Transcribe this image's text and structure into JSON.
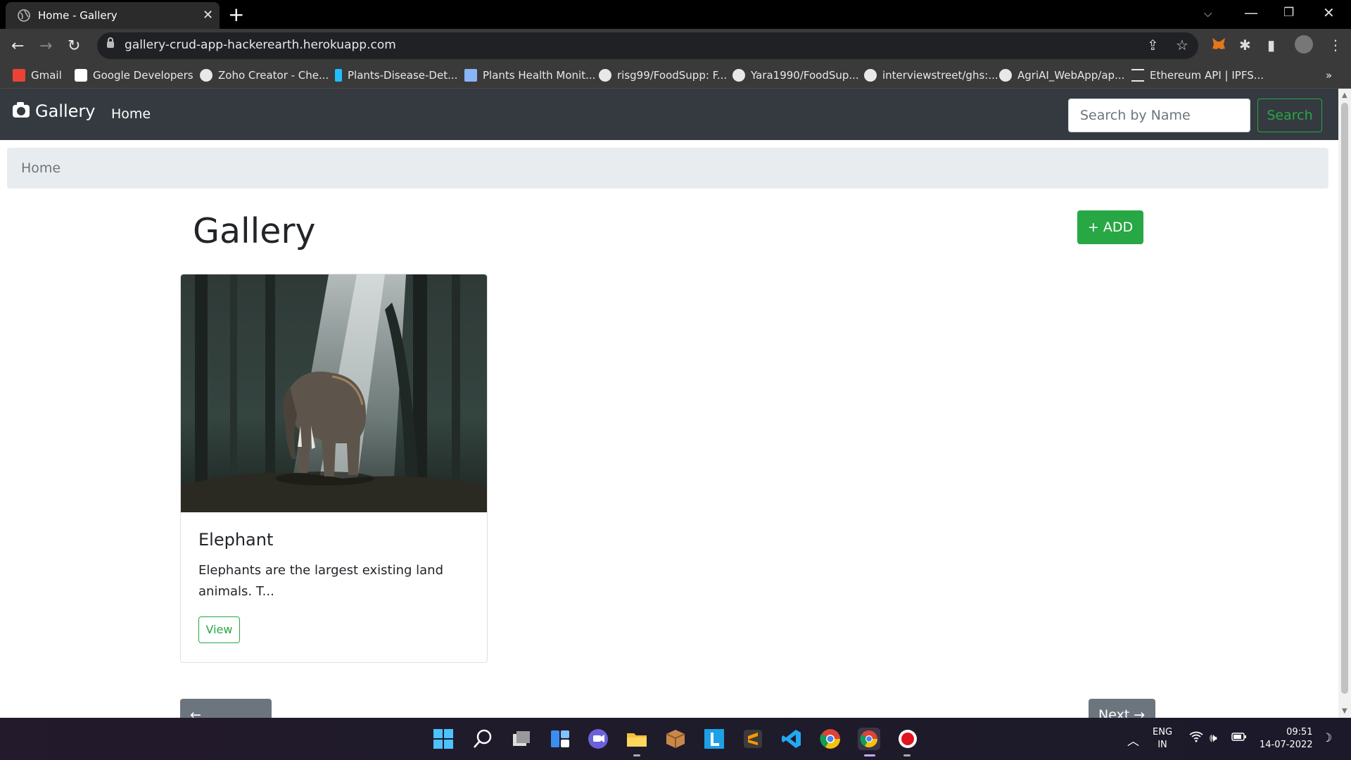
{
  "browser": {
    "tab_title": "Home - Gallery",
    "tab_close": "✕",
    "new_tab": "+",
    "url": "gallery-crud-app-hackerearth.herokuapp.com",
    "bookmarks": [
      "Gmail",
      "Google Developers",
      "Zoho Creator - Che...",
      "Plants-Disease-Det...",
      "Plants Health Monit...",
      "risg99/FoodSupp: F...",
      "Yara1990/FoodSup...",
      "interviewstreet/ghs:...",
      "AgriAI_WebApp/ap...",
      "Ethereum API | IPFS..."
    ],
    "bookmarks_more": "»"
  },
  "navbar": {
    "brand": "Gallery",
    "home_link": "Home",
    "search_placeholder": "Search by Name",
    "search_button": "Search"
  },
  "breadcrumb": {
    "current": "Home"
  },
  "main": {
    "title": "Gallery",
    "add_button": "+ ADD",
    "cards": [
      {
        "title": "Elephant",
        "text": "Elephants are the largest existing land animals. T...",
        "button": "View"
      }
    ],
    "prev_button": "← Previous",
    "next_button": "Next →"
  },
  "taskbar": {
    "lang": "ENG",
    "region": "IN",
    "time": "09:51",
    "date": "14-07-2022"
  },
  "colors": {
    "navbar_bg": "#343a40",
    "accent_green": "#28a745",
    "breadcrumb_bg": "#e9ecef",
    "pager_bg": "#6c757d"
  }
}
